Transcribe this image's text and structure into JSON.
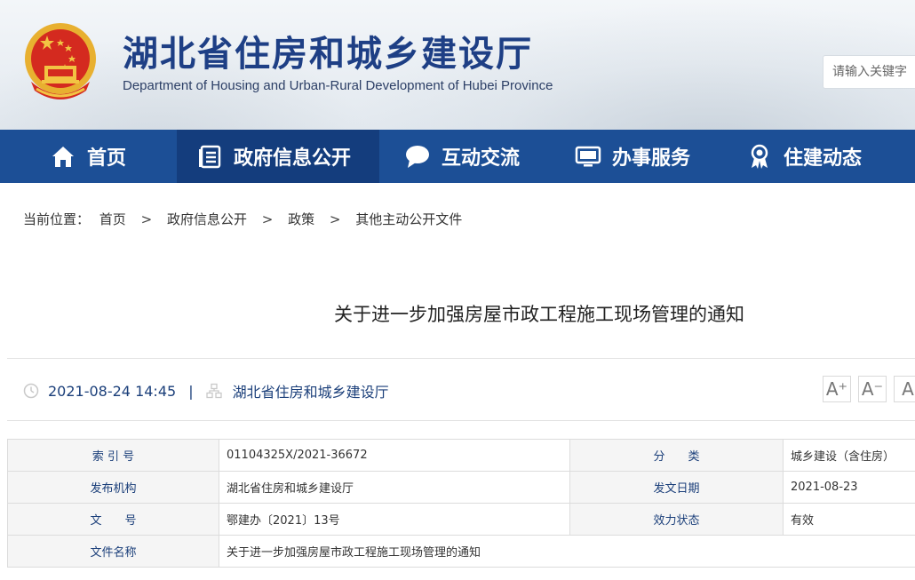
{
  "header": {
    "site_title": "湖北省住房和城乡建设厅",
    "site_subtitle": "Department of Housing and Urban-Rural Development of Hubei Province",
    "emblem_icon": "national-emblem-icon",
    "search": {
      "placeholder": "请输入关键字"
    }
  },
  "nav": {
    "items": [
      {
        "label": "首页",
        "icon": "home-icon"
      },
      {
        "label": "政府信息公开",
        "icon": "document-list-icon",
        "active": true
      },
      {
        "label": "互动交流",
        "icon": "chat-bubble-icon"
      },
      {
        "label": "办事服务",
        "icon": "monitor-icon"
      },
      {
        "label": "住建动态",
        "icon": "award-badge-icon"
      }
    ]
  },
  "breadcrumb": {
    "prefix": "当前位置：",
    "items": [
      "首页",
      "政府信息公开",
      "政策",
      "其他主动公开文件"
    ],
    "separator": ">"
  },
  "article": {
    "title": "关于进一步加强房屋市政工程施工现场管理的通知",
    "datetime": "2021-08-24 14:45",
    "source": "湖北省住房和城乡建设厅",
    "meta_separator": "|",
    "font_controls": [
      "A⁺",
      "A⁻",
      "A"
    ]
  },
  "info_table": {
    "rows": [
      {
        "label1": "索 引 号",
        "value1": "01104325X/2021-36672",
        "label2": "分　　类",
        "value2": "城乡建设（含住房）"
      },
      {
        "label1": "发布机构",
        "value1": "湖北省住房和城乡建设厅",
        "label2": "发文日期",
        "value2": "2021-08-23"
      },
      {
        "label1": "文　　号",
        "value1": "鄂建办〔2021〕13号",
        "label2": "效力状态",
        "value2": "有效"
      },
      {
        "label1": "文件名称",
        "value1": "关于进一步加强房屋市政工程施工现场管理的通知"
      }
    ]
  },
  "colors": {
    "nav_bg": "#1c4f96",
    "nav_active_bg": "#143d7d",
    "title_blue": "#1e3f85",
    "meta_blue": "#1b3f7a"
  }
}
